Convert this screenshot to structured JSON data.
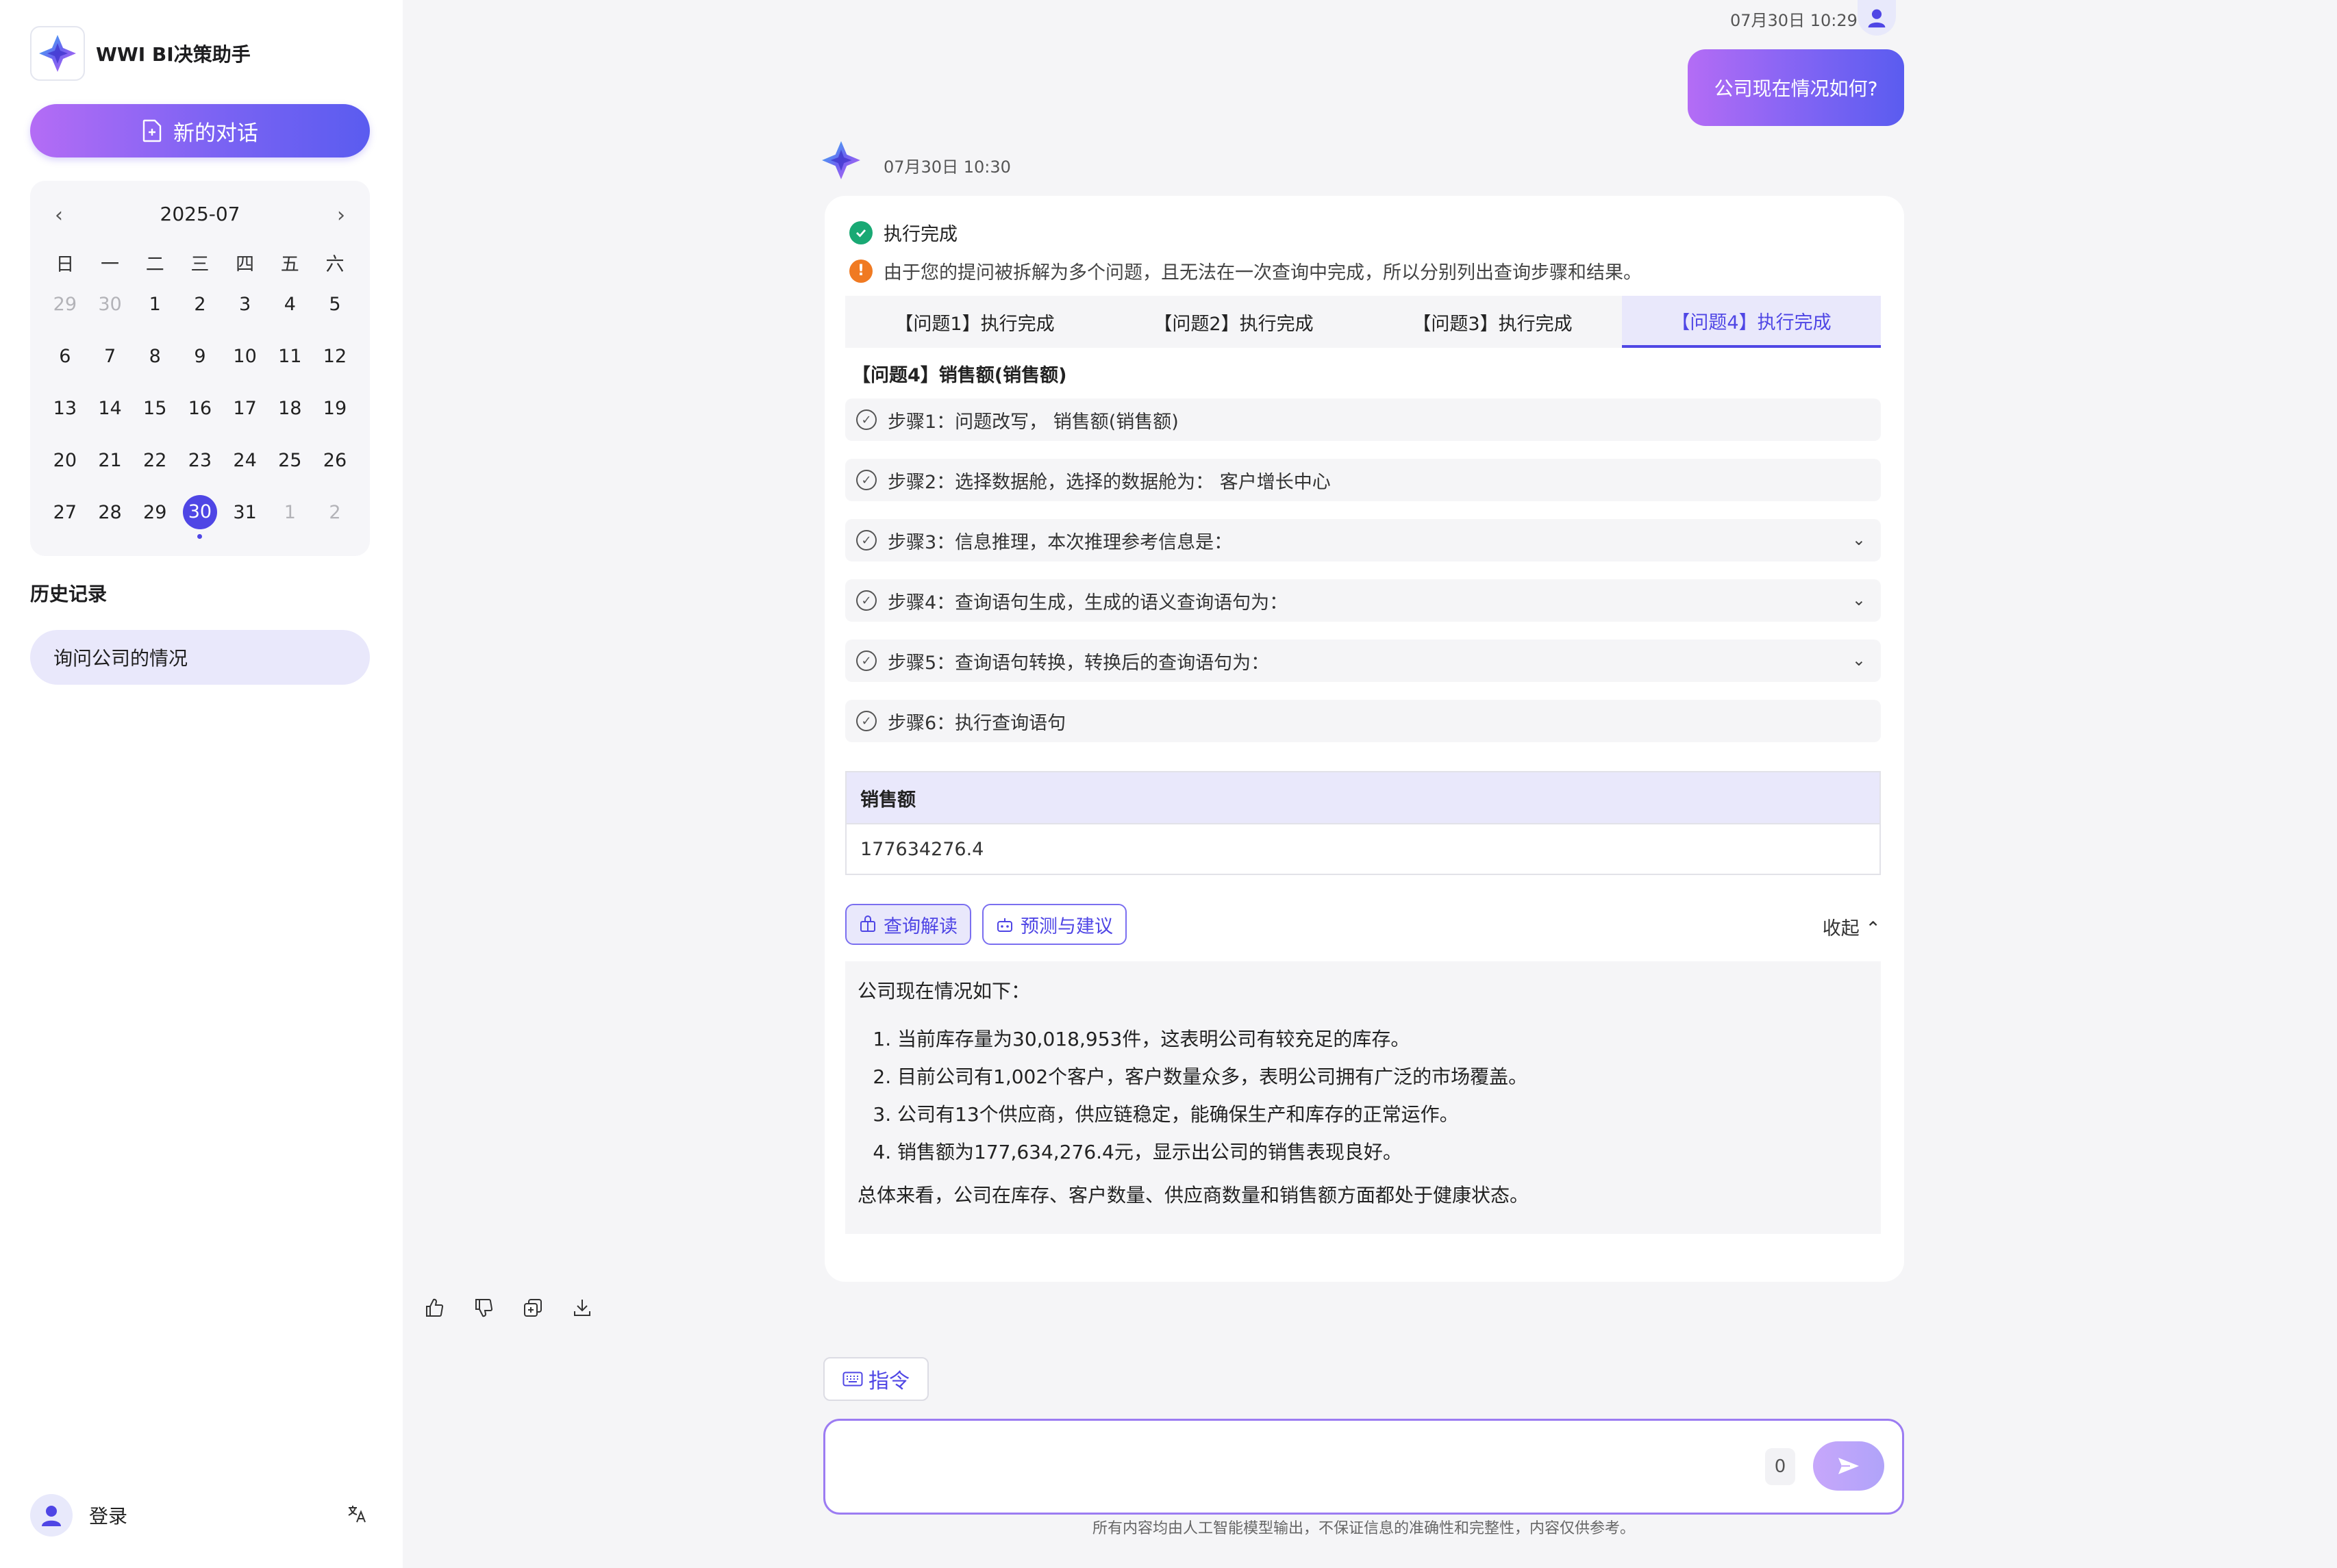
{
  "app": {
    "title": "WWI BI决策助手"
  },
  "sidebar": {
    "new_chat_label": "新的对话",
    "calendar": {
      "month": "2025-07",
      "weekdays": [
        "日",
        "一",
        "二",
        "三",
        "四",
        "五",
        "六"
      ],
      "rows": [
        [
          "29",
          "30",
          "1",
          "2",
          "3",
          "4",
          "5"
        ],
        [
          "6",
          "7",
          "8",
          "9",
          "10",
          "11",
          "12"
        ],
        [
          "13",
          "14",
          "15",
          "16",
          "17",
          "18",
          "19"
        ],
        [
          "20",
          "21",
          "22",
          "23",
          "24",
          "25",
          "26"
        ],
        [
          "27",
          "28",
          "29",
          "30",
          "31",
          "1",
          "2"
        ]
      ],
      "selected_day": "30"
    },
    "history_title": "历史记录",
    "history_items": [
      "询问公司的情况"
    ],
    "login_label": "登录"
  },
  "chat": {
    "user_time": "07月30日 10:29",
    "user_message": "公司现在情况如何?",
    "bot_time": "07月30日 10:30",
    "status_text": "执行完成",
    "warning_text": "由于您的提问被拆解为多个问题，且无法在一次查询中完成，所以分别列出查询步骤和结果。",
    "tabs": [
      "【问题1】执行完成",
      "【问题2】执行完成",
      "【问题3】执行完成",
      "【问题4】执行完成"
    ],
    "active_tab": 3,
    "question_title": "【问题4】销售额(销售额)",
    "steps": [
      {
        "text": "步骤1：问题改写，  销售额(销售额)",
        "expandable": false
      },
      {
        "text": "步骤2：选择数据舱，选择的数据舱为：  客户增长中心",
        "expandable": false
      },
      {
        "text": "步骤3：信息推理，本次推理参考信息是：",
        "expandable": true
      },
      {
        "text": "步骤4：查询语句生成，生成的语义查询语句为：",
        "expandable": true
      },
      {
        "text": "步骤5：查询语句转换，转换后的查询语句为：",
        "expandable": true
      },
      {
        "text": "步骤6：执行查询语句",
        "expandable": false
      }
    ],
    "result_table": {
      "header": "销售额",
      "value": "177634276.4"
    },
    "buttons": {
      "interpret": "查询解读",
      "forecast": "预测与建议",
      "collapse": "收起"
    },
    "analysis": {
      "intro": "公司现在情况如下：",
      "items": [
        "当前库存量为30,018,953件，这表明公司有较充足的库存。",
        "目前公司有1,002个客户，客户数量众多，表明公司拥有广泛的市场覆盖。",
        "公司有13个供应商，供应链稳定，能确保生产和库存的正常运作。",
        "销售额为177,634,276.4元，显示出公司的销售表现良好。"
      ],
      "summary": "总体来看，公司在库存、客户数量、供应商数量和销售额方面都处于健康状态。"
    }
  },
  "composer": {
    "command_label": "指令",
    "char_count": "0",
    "input_value": "",
    "disclaimer": "所有内容均由人工智能模型输出，不保证信息的准确性和完整性，内容仅供参考。"
  },
  "colors": {
    "accent": "#4f46e5",
    "gradient_start": "#b46cf5",
    "gradient_end": "#5a5cf0",
    "success": "#19a974",
    "warning": "#f07a22"
  }
}
